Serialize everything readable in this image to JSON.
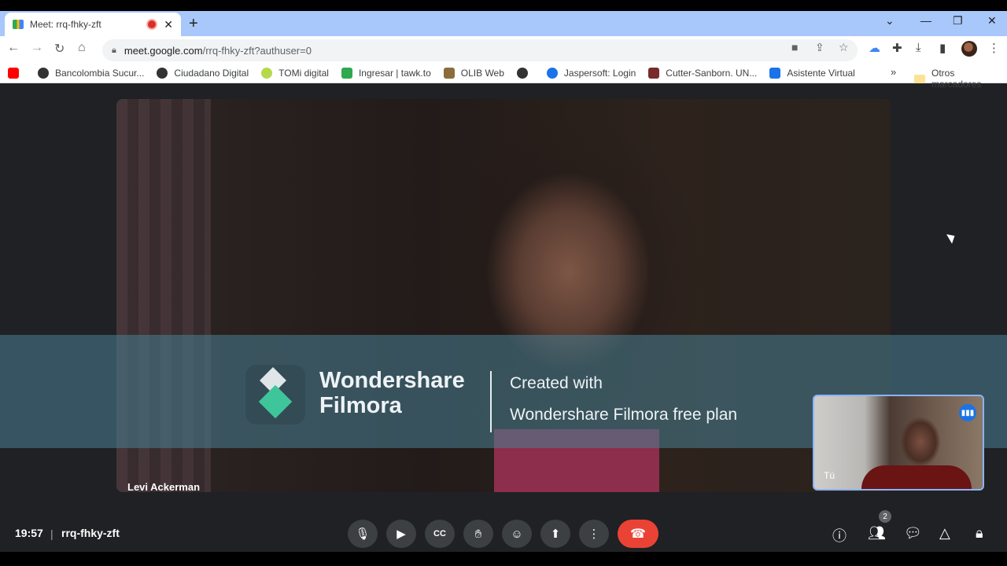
{
  "browser": {
    "tab_title": "Meet: rrq-fhky-zft",
    "new_tab": "+",
    "url_host": "meet.google.com",
    "url_path": "/rrq-fhky-zft?authuser=0",
    "bookmarks": [
      {
        "label": "Bancolombia Sucur...",
        "color": "#333333"
      },
      {
        "label": "Ciudadano Digital",
        "color": "#333333"
      },
      {
        "label": "TOMi digital",
        "color": "#b6d94c"
      },
      {
        "label": "Ingresar | tawk.to",
        "color": "#2fa84f"
      },
      {
        "label": "OLIB Web",
        "color": "#8a6d3b"
      },
      {
        "label": "",
        "color": "#333333"
      },
      {
        "label": "Jaspersoft: Login",
        "color": "#1a73e8"
      },
      {
        "label": "Cutter-Sanborn. UN...",
        "color": "#7a2a2a"
      },
      {
        "label": "Asistente Virtual",
        "color": "#1a73e8"
      }
    ],
    "more_bookmarks": "»",
    "other_bookmarks": "Otros marcadores"
  },
  "meet": {
    "main_participant": "Levi Ackerman",
    "self_label": "Tú",
    "time": "19:57",
    "separator": "|",
    "meeting_code": "rrq-fhky-zft",
    "participants_count": "2"
  },
  "watermark": {
    "brand_line1": "Wondershare",
    "brand_line2": "Filmora",
    "created_line1": "Created with",
    "created_line2": "Wondershare Filmora free plan"
  }
}
